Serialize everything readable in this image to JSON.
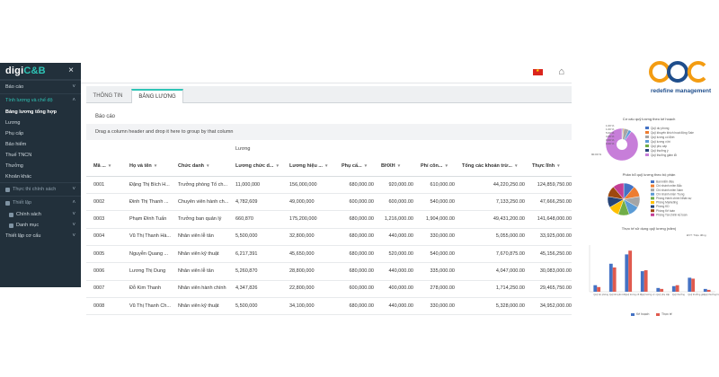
{
  "app": {
    "brand_main": "digi",
    "brand_accent": "C&B",
    "close_icon": "×",
    "flag": "vietnam-flag",
    "home_icon": "⌂"
  },
  "sidebar": {
    "items": [
      {
        "label": "Báo cáo",
        "kind": "group"
      },
      {
        "label": "Tính lương và chế độ",
        "kind": "active-group"
      },
      {
        "label": "Bảng lương tổng hợp",
        "kind": "selected"
      },
      {
        "label": "Lương",
        "kind": "child"
      },
      {
        "label": "Phụ cấp",
        "kind": "child"
      },
      {
        "label": "Bảo hiểm",
        "kind": "child"
      },
      {
        "label": "Thuế TNCN",
        "kind": "child"
      },
      {
        "label": "Thưởng",
        "kind": "child"
      },
      {
        "label": "Khoản khác",
        "kind": "child"
      },
      {
        "label": "Thực thi chính sách",
        "kind": "muted-group"
      },
      {
        "label": "Thiết lập",
        "kind": "muted-group"
      },
      {
        "label": "Chính sách",
        "kind": "sub"
      },
      {
        "label": "Danh mục",
        "kind": "sub"
      },
      {
        "label": "Thiết lập cơ cấu",
        "kind": "sub-plain"
      }
    ]
  },
  "tabs": [
    {
      "label": "THÔNG TIN"
    },
    {
      "label": "BẢNG LƯƠNG"
    }
  ],
  "report_label": "Báo cáo",
  "drag_hint": "Drag a column header and drop it here to group by that column",
  "group_header": "Lương",
  "table": {
    "columns": [
      "Mã ...",
      "Họ và tên",
      "Chức danh",
      "Lương chức d...",
      "Lương hiệu ...",
      "Phụ cấ...",
      "BHXH",
      "Phí côn...",
      "Tổng các khoản trừ...",
      "Thực lĩnh"
    ],
    "rows": [
      [
        "0001",
        "Đặng Thị Bích H...",
        "Trưởng phòng Tổ ch...",
        "11,000,000",
        "156,000,000",
        "680,000.00",
        "920,000.00",
        "610,000.00",
        "44,220,250.00",
        "124,859,750.00"
      ],
      [
        "0002",
        "Đinh Thị Thanh ...",
        "Chuyên viên hành ch...",
        "4,782,609",
        "49,000,000",
        "600,000.00",
        "600,000.00",
        "540,000.00",
        "7,133,250.00",
        "47,666,250.00"
      ],
      [
        "0003",
        "Phạm Đình Tuấn",
        "Trưởng ban quản lý",
        "660,870",
        "175,200,000",
        "680,000.00",
        "1,216,000.00",
        "1,904,000.00",
        "49,431,200.00",
        "141,648,000.00"
      ],
      [
        "0004",
        "Vũ Thị Thanh Hà...",
        "Nhân viên lễ tân",
        "5,500,000",
        "32,800,000",
        "680,000.00",
        "440,000.00",
        "330,000.00",
        "5,055,000.00",
        "33,925,000.00"
      ],
      [
        "0005",
        "Nguyễn Quang ...",
        "Nhân viên kỹ thuật",
        "6,217,391",
        "45,650,000",
        "680,000.00",
        "520,000.00",
        "540,000.00",
        "7,670,875.00",
        "45,156,250.00"
      ],
      [
        "0006",
        "Lương Thị Dung",
        "Nhân viên lễ tân",
        "5,260,870",
        "28,800,000",
        "680,000.00",
        "440,000.00",
        "335,000.00",
        "4,047,000.00",
        "30,083,000.00"
      ],
      [
        "0007",
        "Đỗ Kim Thanh",
        "Nhân viên hành chính",
        "4,347,826",
        "22,800,000",
        "600,000.00",
        "400,000.00",
        "278,000.00",
        "1,714,250.00",
        "29,465,750.00"
      ],
      [
        "0008",
        "Vũ Thị Thanh Ch...",
        "Nhân viên kỹ thuật",
        "5,500,000",
        "34,100,000",
        "680,000.00",
        "440,000.00",
        "330,000.00",
        "5,328,000.00",
        "34,952,000.00"
      ]
    ]
  },
  "brand_right": {
    "tagline": "redefine management"
  },
  "chart_data": [
    {
      "type": "pie",
      "title": "Cơ cấu quỹ lương theo kế hoạch",
      "categories": [
        "Quỹ dự phòng",
        "Quỹ khuyến khích hoạt động Sale",
        "Quỹ lương cố định",
        "Quỹ lương vị trí",
        "Quỹ phụ cấp",
        "Quỹ thưởng ý",
        "Quỹ thưởng giảm lỗi"
      ],
      "values": [
        1,
        1,
        5,
        3,
        0,
        0,
        90
      ],
      "data_labels": [
        "1.00 %",
        "1.00 %",
        "5.00 %",
        "3.00 %",
        "0.00 %",
        "0.00 %",
        "90.00 %"
      ],
      "colors": [
        "#4472c4",
        "#ed7d31",
        "#a5a5a5",
        "#5b9bd5",
        "#70ad47",
        "#264478",
        "#c77ed9"
      ]
    },
    {
      "type": "pie",
      "title": "Phân bổ quỹ lương theo bộ phận",
      "categories": [
        "Ban kiểm điều",
        "Chi nhánh miền Bắc",
        "Chi nhánh miền Nam",
        "Chi nhánh miền Trung",
        "Phòng Hành chính Nhân sự",
        "Phòng Marketing",
        "Phòng KD",
        "Phòng Kế toán",
        "Phòng Tài chính kế toán"
      ],
      "colors": [
        "#4472c4",
        "#ed7d31",
        "#a5a5a5",
        "#5b9bd5",
        "#70ad47",
        "#ffc000",
        "#264478",
        "#9e480e",
        "#c43e96"
      ]
    },
    {
      "type": "bar",
      "title": "Thực tế sử dụng quỹ lương (năm)",
      "unit_label": "ĐVT: Triệu đồng",
      "series": [
        {
          "name": "Kế hoạch",
          "color": "#4472c4"
        },
        {
          "name": "Thực tế",
          "color": "#e05a4e"
        }
      ],
      "categories": [
        "Quỹ dự phòng",
        "Quỹ khuyến khích hoạt động Sale",
        "Quỹ lương cố định",
        "Quỹ lương vị trí",
        "Quỹ phụ cấp",
        "Quỹ thưởng",
        "Quỹ thưởng giảm lỗi",
        "Quỹ thưởng hoạt động SXKD"
      ],
      "planned": [
        70,
        300,
        400,
        220,
        40,
        60,
        150,
        30
      ],
      "actual": [
        50,
        260,
        440,
        230,
        30,
        70,
        140,
        20
      ],
      "ylim": [
        0,
        500
      ]
    }
  ]
}
